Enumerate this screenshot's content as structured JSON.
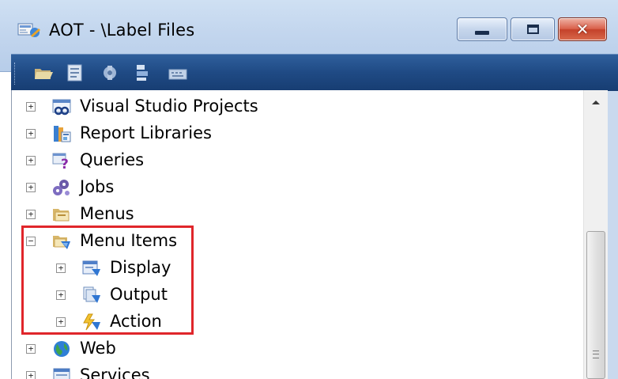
{
  "window": {
    "title": "AOT - \\Label Files",
    "controls": {
      "minimize": "minimize",
      "maximize": "maximize",
      "close": "✕"
    }
  },
  "toolbar": {
    "buttons": [
      "open-folder-icon",
      "properties-icon",
      "compile-icon",
      "import-icon",
      "keyboard-icon"
    ]
  },
  "tree": {
    "nodes": [
      {
        "label": "Visual Studio Projects",
        "expander": "+",
        "icon": "vs-projects-icon"
      },
      {
        "label": "Report Libraries",
        "expander": "+",
        "icon": "report-libraries-icon"
      },
      {
        "label": "Queries",
        "expander": "+",
        "icon": "queries-icon"
      },
      {
        "label": "Jobs",
        "expander": "+",
        "icon": "jobs-icon"
      },
      {
        "label": "Menus",
        "expander": "+",
        "icon": "menus-icon"
      },
      {
        "label": "Menu Items",
        "expander": "−",
        "icon": "menu-items-icon",
        "children": [
          {
            "label": "Display",
            "expander": "+",
            "icon": "display-icon"
          },
          {
            "label": "Output",
            "expander": "+",
            "icon": "output-icon"
          },
          {
            "label": "Action",
            "expander": "+",
            "icon": "action-icon"
          }
        ]
      },
      {
        "label": "Web",
        "expander": "+",
        "icon": "web-globe-icon"
      },
      {
        "label": "Services",
        "expander": "+",
        "icon": "services-icon"
      }
    ]
  },
  "colors": {
    "highlight_border": "#e0262b",
    "toolbar_bg": "#1f4a84",
    "titlebar_bg": "#c3d6ee"
  }
}
